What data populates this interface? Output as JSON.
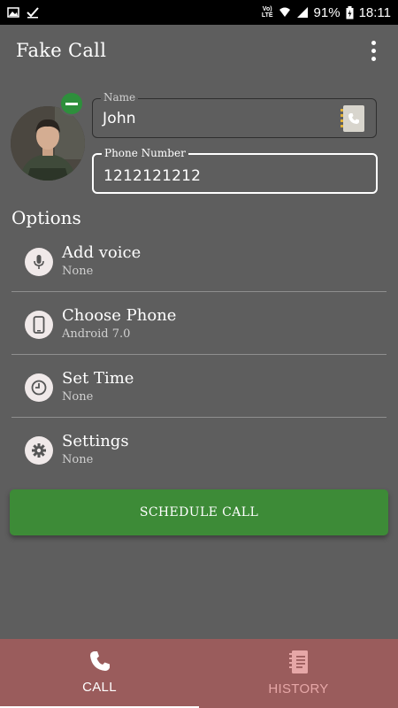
{
  "status_bar": {
    "battery": "91%",
    "time": "18:11",
    "network": "LTE",
    "volte": "Vo)"
  },
  "app_bar": {
    "title": "Fake Call",
    "menu_icon": "more-vert-icon"
  },
  "caller": {
    "avatar": "caller-photo",
    "remove_icon": "remove-icon",
    "name_label": "Name",
    "name_value": "John",
    "phone_label": "Phone Number",
    "phone_value": "1212121212",
    "contact_picker_icon": "contact-book-icon"
  },
  "options": {
    "title": "Options",
    "items": [
      {
        "title": "Add voice",
        "subtitle": "None",
        "icon": "mic-icon"
      },
      {
        "title": "Choose Phone",
        "subtitle": "Android 7.0",
        "icon": "phone-device-icon"
      },
      {
        "title": "Set Time",
        "subtitle": "None",
        "icon": "clock-icon"
      },
      {
        "title": "Settings",
        "subtitle": "None",
        "icon": "gear-icon"
      }
    ]
  },
  "schedule_button": {
    "label": "SCHEDULE CALL"
  },
  "bottom_nav": {
    "items": [
      {
        "label": "CALL",
        "icon": "phone-icon",
        "active": true
      },
      {
        "label": "HISTORY",
        "icon": "history-notebook-icon",
        "active": false
      }
    ]
  },
  "colors": {
    "background": "#5e5e5e",
    "primary_button": "#3d8b37",
    "bottom_nav": "#9a5c5c",
    "badge": "#2e8f3c"
  }
}
